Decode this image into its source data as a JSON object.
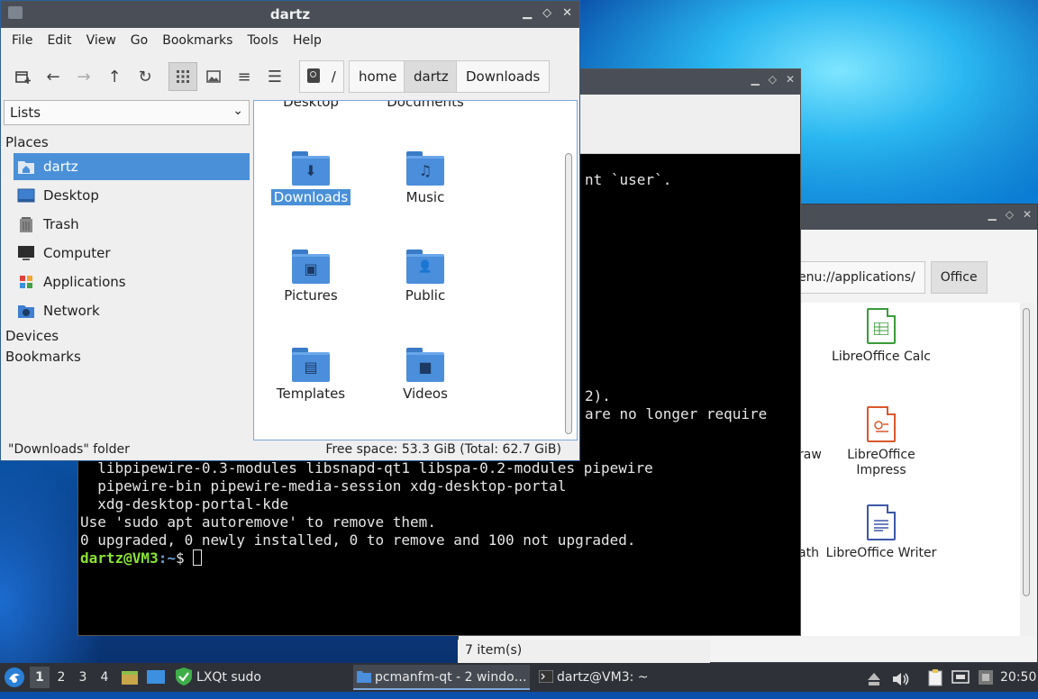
{
  "colors": {
    "accent": "#4a90d9",
    "folder": "#4b8edb",
    "titlebar": "#4a4f57",
    "terminal_bg": "#000000",
    "prompt_user": "#8ae234",
    "prompt_path": "#729fcf"
  },
  "file_manager": {
    "title": "dartz",
    "menu": [
      "File",
      "Edit",
      "View",
      "Go",
      "Bookmarks",
      "Tools",
      "Help"
    ],
    "toolbar_icons": [
      "new-tab-icon",
      "back-arrow-icon",
      "forward-arrow-icon",
      "up-arrow-icon",
      "reload-icon",
      "icon-view-icon",
      "thumbnail-view-icon",
      "compact-view-icon",
      "detailed-list-icon"
    ],
    "path": {
      "root": "/",
      "crumbs": [
        "home",
        "dartz",
        "Downloads"
      ]
    },
    "side_pane_mode": "Lists",
    "places_header": "Places",
    "places": [
      {
        "label": "dartz",
        "icon": "home-folder-icon"
      },
      {
        "label": "Desktop",
        "icon": "desktop-icon"
      },
      {
        "label": "Trash",
        "icon": "trash-icon"
      },
      {
        "label": "Computer",
        "icon": "computer-icon"
      },
      {
        "label": "Applications",
        "icon": "applications-icon"
      },
      {
        "label": "Network",
        "icon": "network-icon"
      }
    ],
    "devices_header": "Devices",
    "bookmarks_header": "Bookmarks",
    "folders_partial": [
      "Desktop",
      "Documents"
    ],
    "folders": [
      {
        "label": "Downloads",
        "glyph": "⬇",
        "icon": "downloads-folder-icon"
      },
      {
        "label": "Music",
        "glyph": "♫",
        "icon": "music-folder-icon"
      },
      {
        "label": "Pictures",
        "glyph": "▣",
        "icon": "pictures-folder-icon"
      },
      {
        "label": "Public",
        "glyph": "👤",
        "icon": "public-folder-icon"
      },
      {
        "label": "Templates",
        "glyph": "▤",
        "icon": "templates-folder-icon"
      },
      {
        "label": "Videos",
        "glyph": "■",
        "icon": "videos-folder-icon"
      }
    ],
    "status_left": "\"Downloads\" folder",
    "status_right": "Free space: 53.3 GiB (Total: 62.7 GiB)"
  },
  "terminal": {
    "frag1": "nt `user`.",
    "frag2": "2).",
    "frag3": "are no longer require",
    "lines": [
      "  libpipewire-0.3-modules libsnapd-qt1 libspa-0.2-modules pipewire",
      "  pipewire-bin pipewire-media-session xdg-desktop-portal",
      "  xdg-desktop-portal-kde",
      "Use 'sudo apt autoremove' to remove them.",
      "0 upgraded, 0 newly installed, 0 to remove and 100 not upgraded."
    ],
    "prompt_user": "dartz@VM3",
    "prompt_path": ":~",
    "prompt_symbol": "$ "
  },
  "apps_window": {
    "path_fragment": "enu://applications/",
    "path_active": "Office",
    "apps": [
      {
        "label": "LibreOffice Calc",
        "icon": "libreoffice-calc-icon"
      },
      {
        "label": "LibreOffice Impress",
        "icon": "libreoffice-impress-icon"
      },
      {
        "label": "LibreOffice Writer",
        "icon": "libreoffice-writer-icon"
      }
    ],
    "side_fragments": [
      "raw",
      "ath"
    ],
    "status": "7 item(s)"
  },
  "taskbar": {
    "desktops": [
      "1",
      "2",
      "3",
      "4"
    ],
    "sudo_label": "LXQt sudo",
    "tasks": [
      {
        "label": "pcmanfm-qt - 2 windo…",
        "icon": "folder-icon"
      },
      {
        "label": "dartz@VM3: ~",
        "icon": "terminal-icon"
      }
    ],
    "clock": "20:50"
  }
}
